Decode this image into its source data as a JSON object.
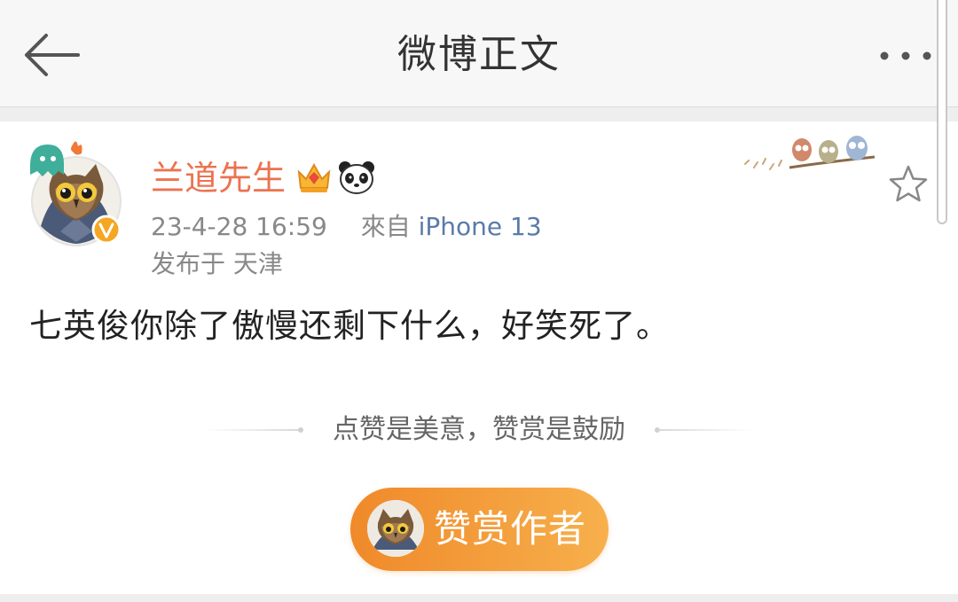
{
  "header": {
    "title": "微博正文",
    "back_icon": "arrow-left-icon",
    "more_icon": "more-dots-icon"
  },
  "post": {
    "username": "兰道先生",
    "timestamp": "23-4-28 16:59",
    "source_prefix": "來自",
    "source": "iPhone 13",
    "location": "发布于 天津",
    "content": "七英俊你除了傲慢还剩下什么，好笑死了。",
    "badges": [
      "crown-icon",
      "panda-icon"
    ],
    "verified_mark": "V"
  },
  "reward": {
    "divider_text": "点赞是美意，赞赏是鼓励",
    "button_label": "赞赏作者"
  },
  "colors": {
    "username": "#eb7350",
    "source_link": "#5a7ba8",
    "reward_gradient_start": "#f0892a",
    "reward_gradient_end": "#f7b04c",
    "verified": "#f5a623"
  }
}
